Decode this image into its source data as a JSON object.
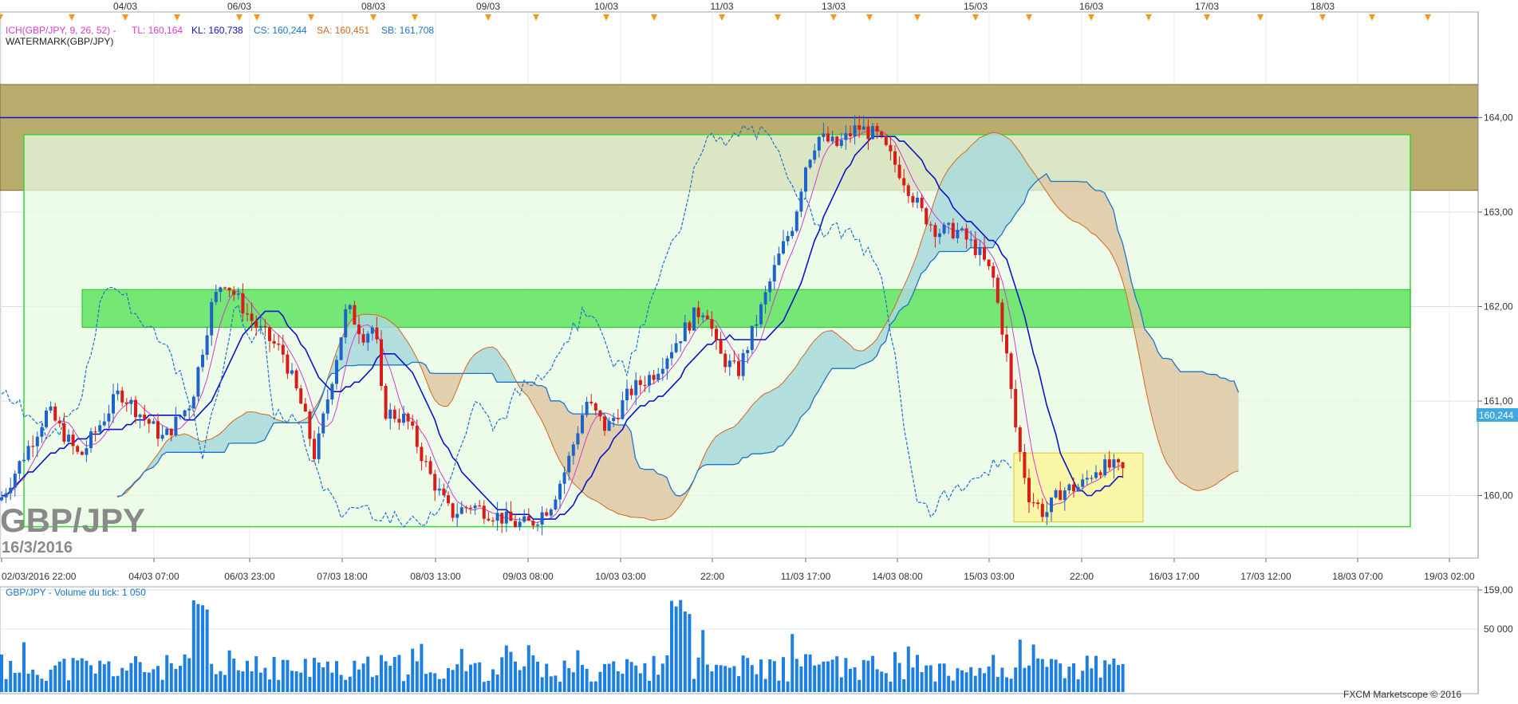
{
  "header": {
    "indicator_line": {
      "ich": "ICH(GBP/JPY, 9, 26, 52) -",
      "tl": "TL: 160,164",
      "kl": "KL: 160,738",
      "cs": "CS: 160,244",
      "sa": "SA: 160,451",
      "sb": "SB: 161,708"
    },
    "watermark_label": "WATERMARK(GBP/JPY)"
  },
  "watermark": {
    "symbol": "GBP/JPY",
    "date": "16/3/2016"
  },
  "price_badge": "160,244",
  "volume_panel": {
    "label": "GBP/JPY - Volume du tick: 1 050",
    "credit": "FXCM Marketscope © 2016"
  },
  "colors": {
    "bull": "#1f63c9",
    "bear": "#d81b1b",
    "tenkan": "#d63bd0",
    "kijun": "#0a14c8",
    "chikou": "#1b74c9",
    "cloud_bull": "#a8d8da",
    "cloud_bear": "#dfc7a3",
    "band_gold": "#b3a35c",
    "band_light_green": "#e6fbe1",
    "band_green": "#5fe35f",
    "box_yellow": "#fbf59b",
    "volume": "#1e7fe3",
    "markers": "#f29a1f"
  },
  "chart_data": [
    {
      "type": "candlestick",
      "top_axis_labels": [
        "04/03",
        "06/03",
        "08/03",
        "09/03",
        "10/03",
        "11/03",
        "13/03",
        "15/03",
        "16/03",
        "17/03",
        "18/03"
      ],
      "bottom_axis_labels": [
        "02/03/2016 22:00",
        "04/03 07:00",
        "06/03 23:00",
        "07/03 18:00",
        "08/03 13:00",
        "09/03 08:00",
        "10/03 03:00",
        "22:00",
        "11/03 17:00",
        "14/03 08:00",
        "15/03 03:00",
        "22:00",
        "16/03 17:00",
        "17/03 12:00",
        "18/03 07:00",
        "19/03 02:00"
      ],
      "y_ticks": [
        "159,00",
        "160,00",
        "161,00",
        "162,00",
        "163,00",
        "164,00"
      ],
      "ylim": [
        158.8,
        164.4
      ],
      "horizontal_line": 164.0,
      "zones": [
        {
          "name": "gold-band",
          "from": 163.23,
          "to": 164.35
        },
        {
          "name": "light-green-range",
          "from": 159.67,
          "to": 163.82
        },
        {
          "name": "green-band",
          "from": 161.78,
          "to": 162.18
        },
        {
          "name": "yellow-box",
          "from": 159.72,
          "to": 160.45
        }
      ],
      "last_price": 160.244,
      "tenkan": 160.164,
      "kijun": 160.738,
      "chikou": 160.244,
      "senkou_a": 160.451,
      "senkou_b": 161.708
    },
    {
      "type": "bar",
      "series": "tick volume",
      "y_ticks": [
        "50 000"
      ],
      "ylim": [
        0,
        80000
      ],
      "last_value": 1050
    }
  ]
}
